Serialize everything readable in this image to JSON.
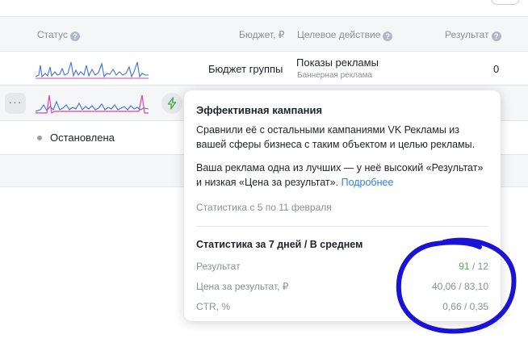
{
  "header": {
    "status": "Статус",
    "budget": "Бюджет, ₽",
    "target_action": "Целевое действие",
    "result": "Результат"
  },
  "rows": [
    {
      "budget": "Бюджет группы",
      "target_action": "Показы рекламы",
      "target_subtitle": "Баннерная реклама",
      "result": "0"
    },
    {
      "dots_label": "···"
    },
    {
      "status": "Остановлена"
    }
  ],
  "popup": {
    "title": "Эффективная кампания",
    "text1": "Сравнили её с остальными кампаниями VK Рекламы из вашей сферы бизнеса с таким объектом и целью рекламы.",
    "text2": "Ваша реклама одна из лучших — у неё высокий «Результат» и низкая «Цена за результат».",
    "link": "Подробнее",
    "period": "Статистика с 5 по 11 февраля",
    "stats_title": "Статистика за 7 дней / В среднем",
    "stats": [
      {
        "label": "Результат",
        "value": "91",
        "avg": " / 12"
      },
      {
        "label": "Цена за результат, ₽",
        "value": "40,06 / 83,10"
      },
      {
        "label": "CTR, %",
        "value": "0,66 / 0,35"
      }
    ]
  },
  "colors": {
    "accent_blue": "#2d81e0",
    "success_green": "#4bb34b",
    "annotation_blue": "#1a12d6",
    "spark_pink": "#e0459a",
    "spark_blue": "#3f72d6"
  },
  "icons": {
    "help": "question-circle-icon",
    "more": "more-dots-icon",
    "bolt": "lightning-icon"
  }
}
